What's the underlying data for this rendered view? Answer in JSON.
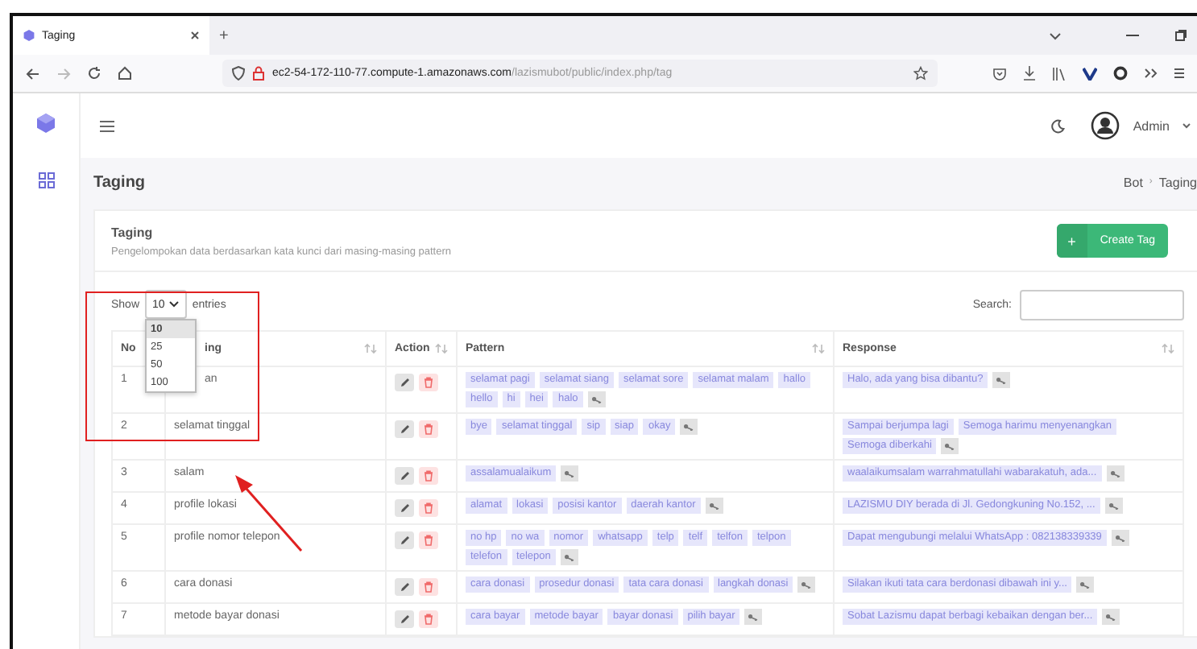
{
  "browser": {
    "tab_title": "Taging",
    "new_tab": "+",
    "url_host": "ec2-54-172-110-77.compute-1.amazonaws.com",
    "url_path": "/lazismubot/public/index.php/tag"
  },
  "header": {
    "user": "Admin"
  },
  "page": {
    "title": "Taging",
    "breadcrumb": [
      "Bot",
      "Taging"
    ],
    "breadcrumb_separator": "›"
  },
  "card": {
    "title": "Taging",
    "subtitle": "Pengelompokan data berdasarkan kata kunci dari masing-masing pattern",
    "create_button": {
      "icon": "+",
      "label": "Create Tag"
    }
  },
  "table_controls": {
    "show_label": "Show",
    "length_value": "10",
    "entries_label": "entries",
    "search_label": "Search:",
    "length_options": [
      {
        "label": "10",
        "selected": true
      },
      {
        "label": "25",
        "selected": false
      },
      {
        "label": "50",
        "selected": false
      },
      {
        "label": "100",
        "selected": false
      }
    ]
  },
  "columns": [
    {
      "label": "No",
      "sortable": false
    },
    {
      "label": "ing",
      "sortable": true
    },
    {
      "label": "Action",
      "sortable": true
    },
    {
      "label": "Pattern",
      "sortable": true
    },
    {
      "label": "Response",
      "sortable": true
    }
  ],
  "rows": [
    {
      "no": "1",
      "tagging": "an",
      "patterns": [
        "selamat pagi",
        "selamat siang",
        "selamat sore",
        "selamat malam",
        "hallo",
        "hello",
        "hi",
        "hei",
        "halo"
      ],
      "responses": [
        "Halo, ada yang bisa dibantu?"
      ]
    },
    {
      "no": "2",
      "tagging": "selamat tinggal",
      "patterns": [
        "bye",
        "selamat tinggal",
        "sip",
        "siap",
        "okay"
      ],
      "responses": [
        "Sampai berjumpa lagi",
        "Semoga harimu menyenangkan",
        "Semoga diberkahi"
      ]
    },
    {
      "no": "3",
      "tagging": "salam",
      "patterns": [
        "assalamualaikum"
      ],
      "responses": [
        "waalaikumsalam warrahmatullahi wabarakatuh, ada..."
      ]
    },
    {
      "no": "4",
      "tagging": "profile lokasi",
      "patterns": [
        "alamat",
        "lokasi",
        "posisi kantor",
        "daerah kantor"
      ],
      "responses": [
        "LAZISMU DIY berada di Jl. Gedongkuning No.152, ..."
      ]
    },
    {
      "no": "5",
      "tagging": "profile nomor telepon",
      "patterns": [
        "no hp",
        "no wa",
        "nomor",
        "whatsapp",
        "telp",
        "telf",
        "telfon",
        "telpon",
        "telefon",
        "telepon"
      ],
      "responses": [
        "Dapat mengubungi melalui WhatsApp : 082138339339"
      ]
    },
    {
      "no": "6",
      "tagging": "cara donasi",
      "patterns": [
        "cara donasi",
        "prosedur donasi",
        "tata cara donasi",
        "langkah donasi"
      ],
      "responses": [
        "Silakan ikuti tata cara berdonasi dibawah ini y..."
      ]
    },
    {
      "no": "7",
      "tagging": "metode bayar donasi",
      "patterns": [
        "cara bayar",
        "metode bayar",
        "bayar donasi",
        "pilih bayar"
      ],
      "responses": [
        "Sobat Lazismu dapat berbagi kebaikan dengan ber..."
      ]
    }
  ]
}
